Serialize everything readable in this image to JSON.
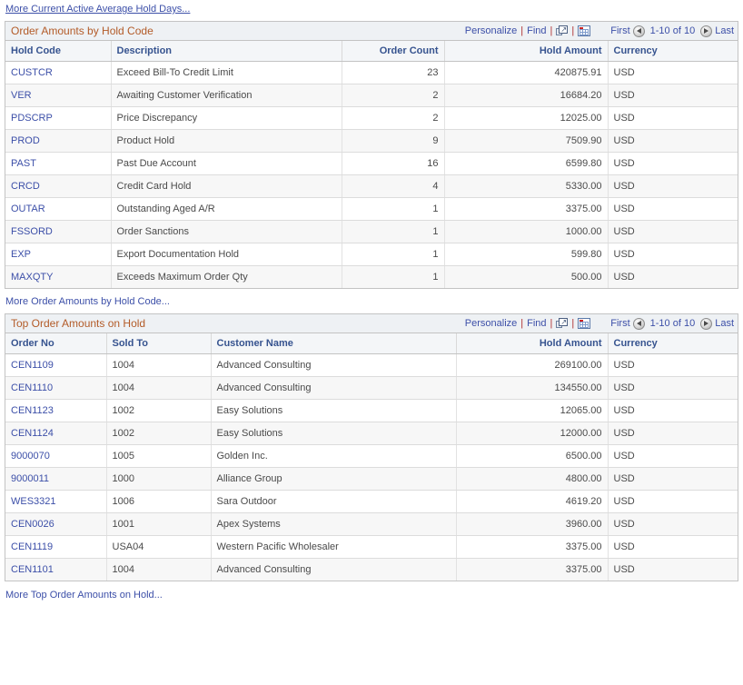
{
  "links": {
    "more_hold_days": "More Current Active Average Hold Days...",
    "more_hold_code": "More Order Amounts by Hold Code...",
    "more_top_order": "More Top Order Amounts on Hold..."
  },
  "toolbar": {
    "personalize": "Personalize",
    "find": "Find",
    "separator": "|",
    "expand_icon": "expand-new-window-icon",
    "spreadsheet_icon": "download-spreadsheet-icon",
    "first": "First",
    "last": "Last",
    "prev_icon": "previous-arrow-icon",
    "next_icon": "next-arrow-icon",
    "range": "1-10 of 10"
  },
  "colors": {
    "title": "#b35b28",
    "link": "#3c4fa8",
    "header_text": "#36538f",
    "separator": "#b03030",
    "grid_border": "#c3c3c3",
    "header_bg": "#f4f6f8",
    "title_bg": "#eef1f4",
    "row_alt_bg": "#f7f7f7"
  },
  "grid1": {
    "title": "Order Amounts by Hold Code",
    "columns": [
      "Hold Code",
      "Description",
      "Order Count",
      "Hold Amount",
      "Currency"
    ],
    "rows": [
      {
        "hold_code": "CUSTCR",
        "description": "Exceed Bill-To Credit Limit",
        "order_count": "23",
        "hold_amount": "420875.91",
        "currency": "USD"
      },
      {
        "hold_code": "VER",
        "description": "Awaiting Customer Verification",
        "order_count": "2",
        "hold_amount": "16684.20",
        "currency": "USD"
      },
      {
        "hold_code": "PDSCRP",
        "description": "Price Discrepancy",
        "order_count": "2",
        "hold_amount": "12025.00",
        "currency": "USD"
      },
      {
        "hold_code": "PROD",
        "description": "Product Hold",
        "order_count": "9",
        "hold_amount": "7509.90",
        "currency": "USD"
      },
      {
        "hold_code": "PAST",
        "description": "Past Due Account",
        "order_count": "16",
        "hold_amount": "6599.80",
        "currency": "USD"
      },
      {
        "hold_code": "CRCD",
        "description": "Credit Card Hold",
        "order_count": "4",
        "hold_amount": "5330.00",
        "currency": "USD"
      },
      {
        "hold_code": "OUTAR",
        "description": "Outstanding Aged A/R",
        "order_count": "1",
        "hold_amount": "3375.00",
        "currency": "USD"
      },
      {
        "hold_code": "FSSORD",
        "description": "Order Sanctions",
        "order_count": "1",
        "hold_amount": "1000.00",
        "currency": "USD"
      },
      {
        "hold_code": "EXP",
        "description": "Export Documentation Hold",
        "order_count": "1",
        "hold_amount": "599.80",
        "currency": "USD"
      },
      {
        "hold_code": "MAXQTY",
        "description": "Exceeds Maximum Order Qty",
        "order_count": "1",
        "hold_amount": "500.00",
        "currency": "USD"
      }
    ]
  },
  "grid2": {
    "title": "Top Order Amounts on Hold",
    "columns": [
      "Order No",
      "Sold To",
      "Customer Name",
      "Hold Amount",
      "Currency"
    ],
    "rows": [
      {
        "order_no": "CEN1109",
        "sold_to": "1004",
        "customer_name": "Advanced Consulting",
        "hold_amount": "269100.00",
        "currency": "USD"
      },
      {
        "order_no": "CEN1110",
        "sold_to": "1004",
        "customer_name": "Advanced Consulting",
        "hold_amount": "134550.00",
        "currency": "USD"
      },
      {
        "order_no": "CEN1123",
        "sold_to": "1002",
        "customer_name": "Easy Solutions",
        "hold_amount": "12065.00",
        "currency": "USD"
      },
      {
        "order_no": "CEN1124",
        "sold_to": "1002",
        "customer_name": "Easy Solutions",
        "hold_amount": "12000.00",
        "currency": "USD"
      },
      {
        "order_no": "9000070",
        "sold_to": "1005",
        "customer_name": "Golden Inc.",
        "hold_amount": "6500.00",
        "currency": "USD"
      },
      {
        "order_no": "9000011",
        "sold_to": "1000",
        "customer_name": "Alliance Group",
        "hold_amount": "4800.00",
        "currency": "USD"
      },
      {
        "order_no": "WES3321",
        "sold_to": "1006",
        "customer_name": "Sara Outdoor",
        "hold_amount": "4619.20",
        "currency": "USD"
      },
      {
        "order_no": "CEN0026",
        "sold_to": "1001",
        "customer_name": "Apex Systems",
        "hold_amount": "3960.00",
        "currency": "USD"
      },
      {
        "order_no": "CEN1119",
        "sold_to": "USA04",
        "customer_name": "Western Pacific Wholesaler",
        "hold_amount": "3375.00",
        "currency": "USD"
      },
      {
        "order_no": "CEN1101",
        "sold_to": "1004",
        "customer_name": "Advanced Consulting",
        "hold_amount": "3375.00",
        "currency": "USD"
      }
    ]
  }
}
